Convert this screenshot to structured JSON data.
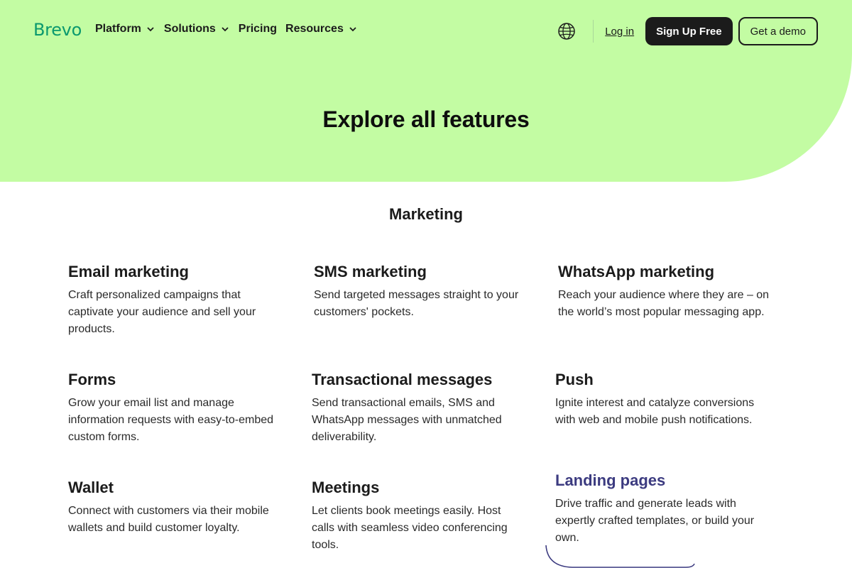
{
  "nav": {
    "logo": "Brevo",
    "menu": [
      {
        "label": "Platform",
        "has_dropdown": true
      },
      {
        "label": "Solutions",
        "has_dropdown": true
      },
      {
        "label": "Pricing",
        "has_dropdown": false
      },
      {
        "label": "Resources",
        "has_dropdown": true
      }
    ],
    "login": "Log in",
    "signup": "Sign Up Free",
    "demo": "Get a demo"
  },
  "hero": {
    "title": "Explore all features"
  },
  "section": {
    "title": "Marketing"
  },
  "features": [
    {
      "title": "Email marketing",
      "description": "Craft personalized campaigns that captivate your audience and sell your products."
    },
    {
      "title": "SMS marketing",
      "description": "Send targeted messages straight to your customers' pockets."
    },
    {
      "title": "WhatsApp marketing",
      "description": "Reach your audience where they are – on the world’s most popular messaging app."
    },
    {
      "title": "Forms",
      "description": "Grow your email list and manage information requests with easy-to-embed custom forms."
    },
    {
      "title": "Transactional messages",
      "description": "Send transactional emails, SMS and WhatsApp messages with unmatched deliverability."
    },
    {
      "title": "Push",
      "description": "Ignite interest and catalyze conversions with web and mobile push notifications."
    },
    {
      "title": "Wallet",
      "description": "Connect with customers via their mobile wallets and build customer loyalty."
    },
    {
      "title": "Meetings",
      "description": "Let clients book meetings easily. Host calls with seamless video conferencing tools."
    },
    {
      "title": "Landing pages",
      "description": "Drive traffic and generate leads with expertly crafted templates, or build your own."
    }
  ],
  "colors": {
    "hero_bg": "#c3fca3",
    "brand": "#0b996e",
    "dark": "#1b1b1b",
    "hover_accent": "#3c3b80"
  }
}
